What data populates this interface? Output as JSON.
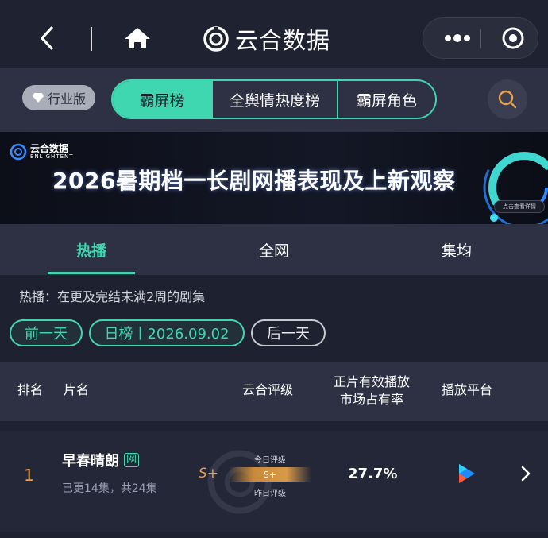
{
  "header": {
    "title": "云合数据",
    "icons": [
      "back-icon",
      "home-icon",
      "more-icon",
      "close-icon"
    ]
  },
  "toolbar": {
    "industry_badge": "行业版",
    "segments": [
      {
        "label": "霸屏榜",
        "active": true
      },
      {
        "label": "全舆情热度榜",
        "active": false
      },
      {
        "label": "霸屏角色",
        "active": false
      }
    ],
    "accent": "#3fd7b0"
  },
  "banner": {
    "logo_text": "云合数据",
    "logo_sub": "ENLIGHTENT",
    "title": "2026暑期档一长剧网播表现及上新观察",
    "cta": "点击查看详情"
  },
  "tabs": [
    {
      "label": "热播",
      "active": true
    },
    {
      "label": "全网",
      "active": false
    },
    {
      "label": "集均",
      "active": false
    }
  ],
  "note": "热播：在更及完结未满2周的剧集",
  "date_nav": {
    "prev": "前一天",
    "current": "日榜丨2026.09.02",
    "next": "后一天"
  },
  "table": {
    "headers": {
      "rank": "排名",
      "title": "片名",
      "grade": "云合评级",
      "share_line1": "正片有效播放",
      "share_line2": "市场占有率",
      "platform": "播放平台"
    },
    "rows": [
      {
        "rank": "1",
        "title": "早春晴朗",
        "badge": "网",
        "episodes": "已更14集，共24集",
        "grade": "S+",
        "today_label": "今日评级",
        "bar_grade": "S+",
        "yesterday_label": "昨日评级",
        "share": "27.7%",
        "platform_icon": "youku-icon"
      }
    ]
  }
}
